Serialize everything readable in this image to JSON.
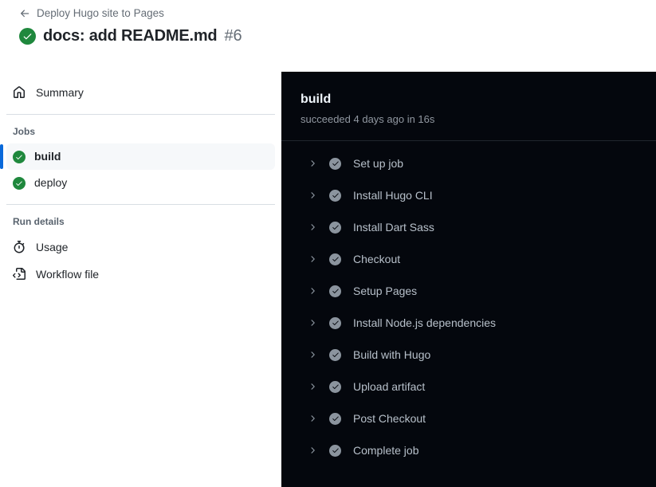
{
  "header": {
    "breadcrumb": {
      "back_icon": "arrow-left-icon",
      "label": "Deploy Hugo site to Pages"
    },
    "run": {
      "status_icon": "check-circle-fill-icon",
      "status_color": "#1f883d",
      "title": "docs: add README.md",
      "number": "#6"
    }
  },
  "sidebar": {
    "summary": {
      "icon": "home-icon",
      "label": "Summary"
    },
    "jobs_section_label": "Jobs",
    "jobs": [
      {
        "label": "build",
        "status_icon": "check-circle-fill-icon",
        "selected": true
      },
      {
        "label": "deploy",
        "status_icon": "check-circle-fill-icon",
        "selected": false
      }
    ],
    "run_details_section_label": "Run details",
    "run_details": [
      {
        "label": "Usage",
        "icon": "stopwatch-icon"
      },
      {
        "label": "Workflow file",
        "icon": "file-code-icon"
      }
    ],
    "selected_accent_color": "#0969da"
  },
  "log_panel": {
    "job_name": "build",
    "job_status": "succeeded 4 days ago in 16s",
    "background_color": "#04070d",
    "steps": [
      {
        "label": "Set up job",
        "status_icon": "check-circle-fill-icon",
        "expand_icon": "chevron-right-icon"
      },
      {
        "label": "Install Hugo CLI",
        "status_icon": "check-circle-fill-icon",
        "expand_icon": "chevron-right-icon"
      },
      {
        "label": "Install Dart Sass",
        "status_icon": "check-circle-fill-icon",
        "expand_icon": "chevron-right-icon"
      },
      {
        "label": "Checkout",
        "status_icon": "check-circle-fill-icon",
        "expand_icon": "chevron-right-icon"
      },
      {
        "label": "Setup Pages",
        "status_icon": "check-circle-fill-icon",
        "expand_icon": "chevron-right-icon"
      },
      {
        "label": "Install Node.js dependencies",
        "status_icon": "check-circle-fill-icon",
        "expand_icon": "chevron-right-icon"
      },
      {
        "label": "Build with Hugo",
        "status_icon": "check-circle-fill-icon",
        "expand_icon": "chevron-right-icon"
      },
      {
        "label": "Upload artifact",
        "status_icon": "check-circle-fill-icon",
        "expand_icon": "chevron-right-icon"
      },
      {
        "label": "Post Checkout",
        "status_icon": "check-circle-fill-icon",
        "expand_icon": "chevron-right-icon"
      },
      {
        "label": "Complete job",
        "status_icon": "check-circle-fill-icon",
        "expand_icon": "chevron-right-icon"
      }
    ]
  }
}
